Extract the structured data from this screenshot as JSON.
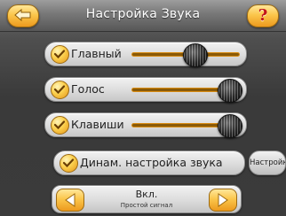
{
  "header": {
    "title": "Настройка Звука",
    "back_icon": "back-arrow-icon",
    "help_label": "?",
    "accent": "#f4b23a"
  },
  "rows": [
    {
      "label": "Главный",
      "enabled": true,
      "level": 0.72
    },
    {
      "label": "Голос",
      "enabled": true,
      "level": 1.0
    },
    {
      "label": "Клавиши",
      "enabled": true,
      "level": 1.0
    }
  ],
  "dynamic": {
    "label": "Динам. настройка звука",
    "enabled": true,
    "settings_button": "Настройки"
  },
  "selector": {
    "value": "Вкл.",
    "subtitle": "Простой сигнал",
    "prev_icon": "arrow-left-icon",
    "next_icon": "arrow-right-icon"
  }
}
